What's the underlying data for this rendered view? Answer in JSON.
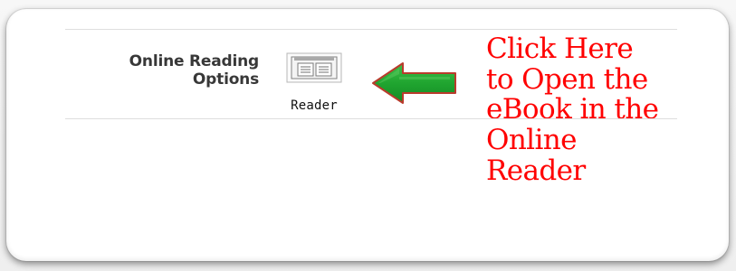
{
  "section": {
    "label_lines": [
      "Online Reading",
      "Options"
    ],
    "reader_button_label": "Reader"
  },
  "annotation": {
    "lines": [
      "Click Here",
      "to Open the",
      "eBook in the",
      "Online",
      "Reader"
    ],
    "text_color": "#ff0000",
    "arrow_color": "#22a33a"
  },
  "icons": {
    "reader": "book-reader-icon",
    "arrow": "left-arrow-icon"
  }
}
